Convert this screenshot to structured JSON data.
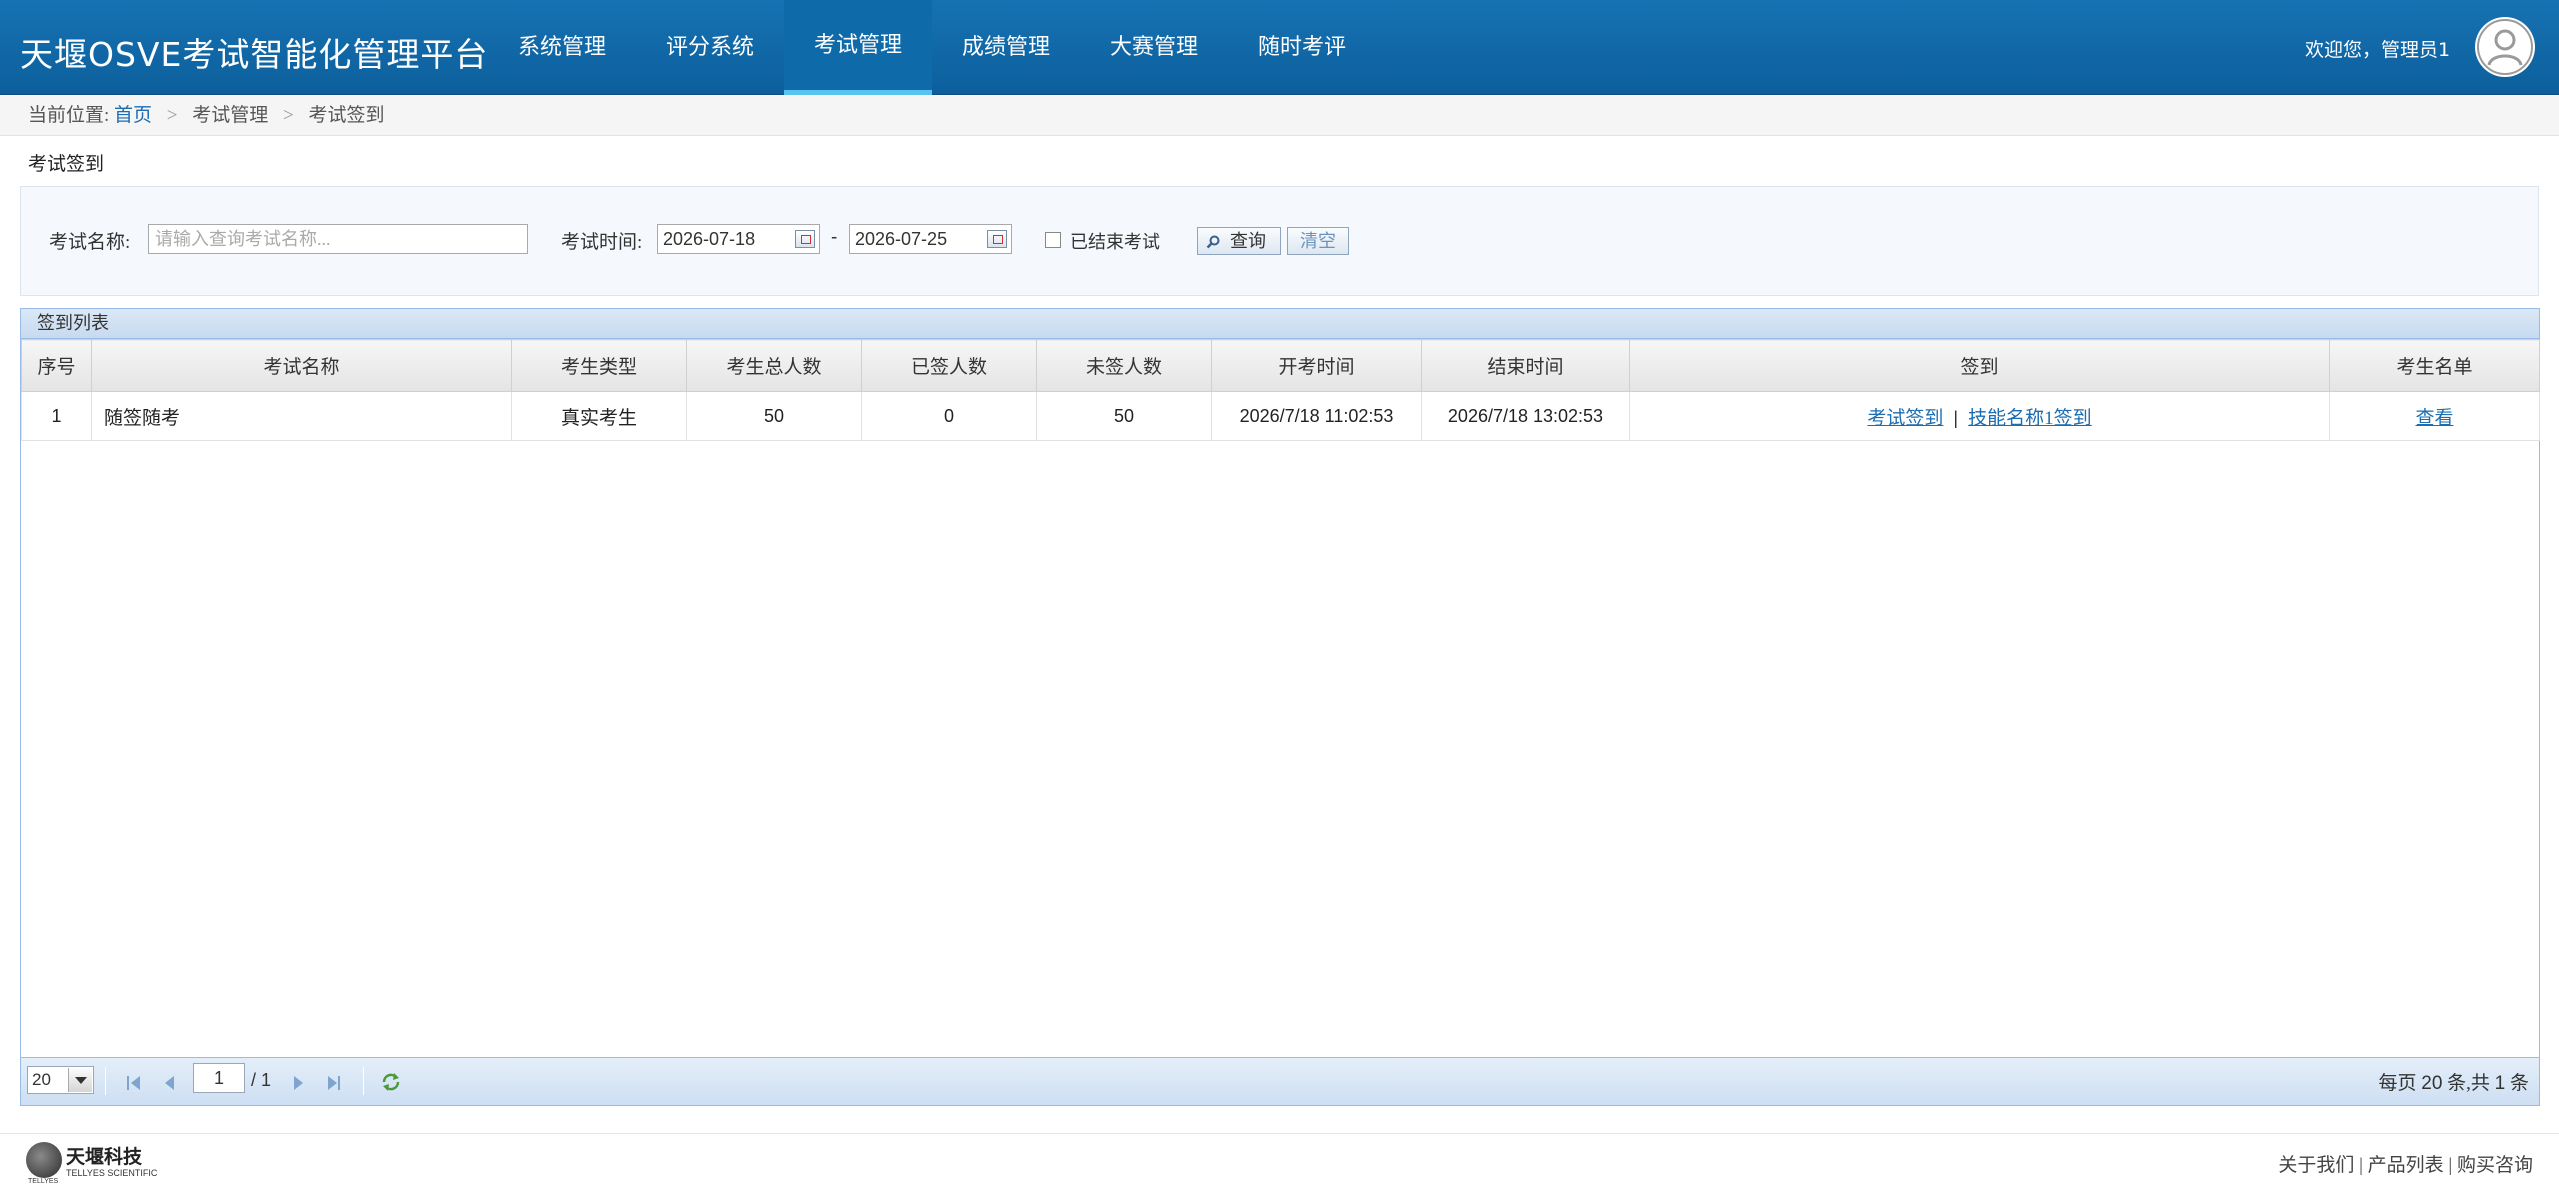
{
  "app": {
    "title": "天堰OSVE考试智能化管理平台",
    "welcome": "欢迎您，管理员1"
  },
  "nav": {
    "items": [
      {
        "label": "系统管理"
      },
      {
        "label": "评分系统"
      },
      {
        "label": "考试管理",
        "active": true
      },
      {
        "label": "成绩管理"
      },
      {
        "label": "大赛管理"
      },
      {
        "label": "随时考评"
      }
    ]
  },
  "breadcrumb": {
    "prefix": "当前位置:",
    "home": "首页",
    "level1": "考试管理",
    "level2": "考试签到",
    "separator": ">"
  },
  "page_title": "考试签到",
  "search": {
    "name_label": "考试名称:",
    "name_placeholder": "请输入查询考试名称...",
    "name_value": "",
    "time_label": "考试时间:",
    "date_from": "2026-07-18",
    "date_dash": "-",
    "date_to": "2026-07-25",
    "ended_label": "已结束考试",
    "ended_checked": false,
    "query_label": "查询",
    "clear_label": "清空"
  },
  "grid": {
    "title": "签到列表",
    "columns": [
      "序号",
      "考试名称",
      "考生类型",
      "考生总人数",
      "已签人数",
      "未签人数",
      "开考时间",
      "结束时间",
      "签到",
      "考生名单"
    ],
    "rows": [
      {
        "index": "1",
        "name": "随签随考",
        "type": "真实考生",
        "total": "50",
        "signed": "0",
        "unsigned": "50",
        "start": "2026/7/18 11:02:53",
        "end": "2026/7/18 13:02:53",
        "signin_exam": "考试签到",
        "signin_sep": "|",
        "signin_skill": "技能名称1签到",
        "roster": "查看"
      }
    ]
  },
  "pager": {
    "page_size": "20",
    "current_page": "1",
    "total_pages": "/ 1",
    "info_prefix": "每页",
    "info_size": "20",
    "info_mid": "条,共",
    "info_total": "1",
    "info_suffix": "条"
  },
  "footer": {
    "brand": "天堰科技",
    "brand_en": "TELLYES SCIENTIFIC",
    "brand_small": "TELLYES",
    "links": [
      "关于我们",
      "产品列表",
      "购买咨询"
    ],
    "link_sep": "|"
  },
  "colors": {
    "header_bg": "#1772b3",
    "active_underline": "#58c3f0",
    "link": "#1b6cb0",
    "grid_border": "#99bbe8"
  },
  "icons": [
    "user-avatar-icon",
    "calendar-icon",
    "search-icon",
    "first-page-icon",
    "prev-page-icon",
    "next-page-icon",
    "last-page-icon",
    "refresh-icon",
    "dropdown-arrow-icon"
  ]
}
